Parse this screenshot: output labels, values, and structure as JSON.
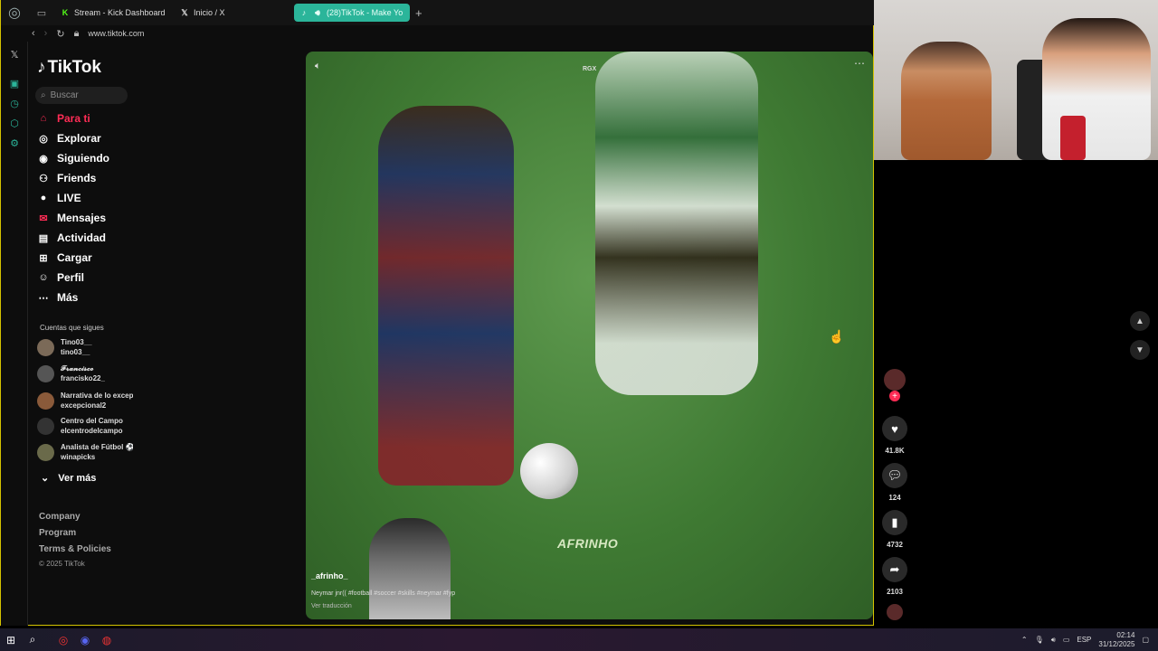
{
  "browser": {
    "tabs": [
      {
        "label": "Stream - Kick Dashboard",
        "icon": "kick-icon"
      },
      {
        "label": "Inicio / X",
        "icon": "x-icon"
      },
      {
        "label": "(28)TikTok - Make Yo",
        "icon": "tiktok-icon",
        "active": true
      }
    ],
    "new_tab": "+",
    "url": "www.tiktok.com",
    "accent": "#2bb59a"
  },
  "tiktok": {
    "logo": "TikTok",
    "search_placeholder": "Buscar",
    "nav": [
      {
        "label": "Para ti",
        "icon": "home-icon"
      },
      {
        "label": "Explorar",
        "icon": "compass-icon"
      },
      {
        "label": "Siguiendo",
        "icon": "following-icon"
      },
      {
        "label": "Friends",
        "icon": "friends-icon"
      },
      {
        "label": "LIVE",
        "icon": "live-icon"
      },
      {
        "label": "Mensajes",
        "icon": "messages-icon"
      },
      {
        "label": "Actividad",
        "icon": "activity-icon"
      },
      {
        "label": "Cargar",
        "icon": "upload-icon"
      },
      {
        "label": "Perfil",
        "icon": "profile-icon"
      },
      {
        "label": "Más",
        "icon": "more-icon"
      }
    ],
    "following_title": "Cuentas que sigues",
    "accounts": [
      {
        "name": "Tino03__",
        "handle": "tino03__"
      },
      {
        "name": "𝓕𝓻𝓪𝓷𝓬𝓲𝓼𝓬𝓸",
        "handle": "francisko22_"
      },
      {
        "name": "Narrativa de lo excepc",
        "handle": "excepcional2"
      },
      {
        "name": "Centro del Campo",
        "handle": "elcentrodelcampo"
      },
      {
        "name": "Analista de Fútbol ⚽",
        "handle": "winapicks"
      }
    ],
    "see_more": "Ver más",
    "footer": [
      "Company",
      "Program",
      "Terms & Policies"
    ],
    "copyright": "© 2025 TikTok"
  },
  "video": {
    "top_label": "RGX",
    "watermark": "AFRINHO",
    "author": "_afrinho_",
    "description": "Neymar jnr(( #football #soccer #skills #neymar #fyp",
    "translate": "Ver traducción",
    "likes": "41.8K",
    "comments": "124",
    "saves": "4732",
    "shares": "2103"
  },
  "strip": {
    "gx": "GX",
    "dots": "···"
  },
  "taskbar": {
    "lang": "ESP",
    "time": "02:14",
    "date": "31/12/2025"
  }
}
